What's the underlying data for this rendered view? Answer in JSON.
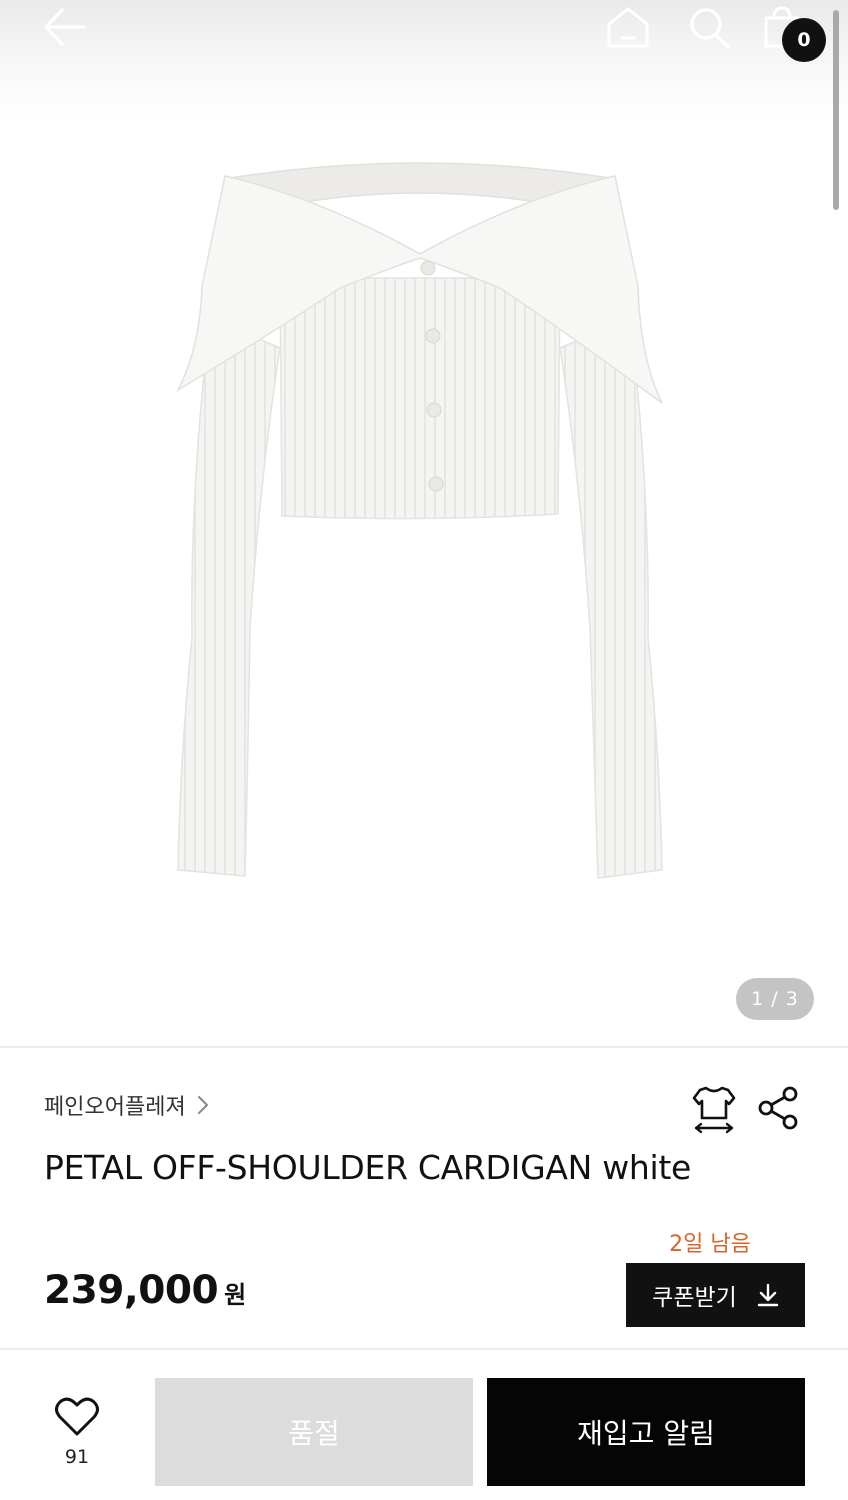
{
  "header": {
    "back_icon": "arrow-left-icon",
    "home_icon": "home-icon",
    "search_icon": "search-icon",
    "cart_icon": "shopping-bag-icon",
    "cart_count": "0"
  },
  "gallery": {
    "current": 1,
    "total": 3,
    "counter_label": "1 / 3",
    "image_description_icon": "cardigan-product-photo"
  },
  "product": {
    "brand": "페인오어플레져",
    "title": "PETAL OFF-SHOULDER CARDIGAN white",
    "size_icon": "size-guide-icon",
    "share_icon": "share-icon",
    "days_left": "2일 남음",
    "price": "239,000",
    "currency": "원",
    "coupon_label": "쿠폰받기",
    "coupon_icon": "download-icon"
  },
  "bottom_bar": {
    "like_icon": "heart-icon",
    "like_count": "91",
    "soldout_label": "품절",
    "restock_label": "재입고 알림"
  },
  "colors": {
    "accent_orange": "#d9622b",
    "black": "#111111",
    "soldout_gray": "#dcdcdc",
    "counter_gray": "#c4c4c4"
  }
}
